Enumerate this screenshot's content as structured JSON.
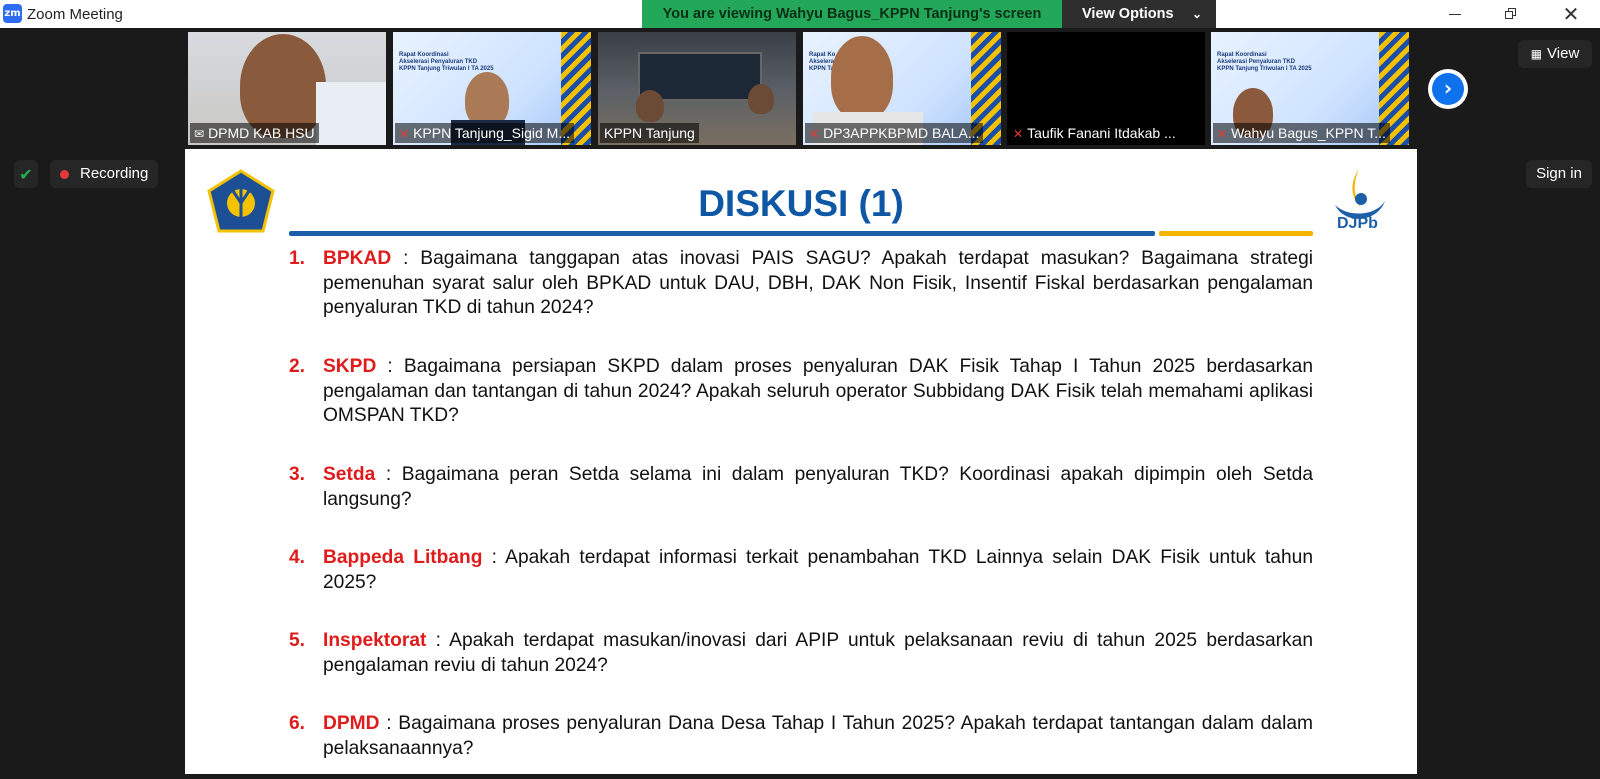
{
  "window": {
    "title": "Zoom Meeting",
    "logo_text": "zm"
  },
  "banner": {
    "text": "You are viewing Wahyu Bagus_KPPN Tanjung's screen",
    "view_options": "View Options"
  },
  "participants": [
    {
      "name": "DPMD KAB HSU",
      "muted": false
    },
    {
      "name": "KPPN Tanjung_Sigid M...",
      "muted": true
    },
    {
      "name": "KPPN Tanjung",
      "muted": false
    },
    {
      "name": "DP3APPKBPMD BALA...",
      "muted": true
    },
    {
      "name": "Taufik Fanani Itdakab ...",
      "muted": true
    },
    {
      "name": "Wahyu Bagus_KPPN T...",
      "muted": true
    }
  ],
  "controls": {
    "view": "View",
    "recording": "Recording",
    "sign_in": "Sign in"
  },
  "colors": {
    "accent": "#0e72ed",
    "banner": "#23a85a",
    "recording": "#e5383b",
    "slide_title": "#0e57a4",
    "heading_red": "#e01b1b"
  },
  "slide": {
    "title": "DISKUSI (1)",
    "brand": "DJPb",
    "questions": [
      {
        "num": "1.",
        "head": "BPKAD",
        "text": " : Bagaimana tanggapan atas inovasi PAIS SAGU? Apakah terdapat masukan? Bagaimana strategi pemenuhan syarat salur oleh BPKAD untuk DAU, DBH, DAK Non Fisik, Insentif Fiskal berdasarkan pengalaman penyaluran TKD di tahun 2024?"
      },
      {
        "num": "2.",
        "head": "SKPD",
        "text": " : Bagaimana persiapan SKPD dalam proses penyaluran DAK Fisik Tahap I Tahun 2025 berdasarkan pengalaman dan tantangan di tahun 2024? Apakah seluruh operator Subbidang DAK Fisik telah memahami aplikasi OMSPAN TKD?"
      },
      {
        "num": "3.",
        "head": "Setda",
        "text": " : Bagaimana peran Setda selama ini dalam penyaluran TKD? Koordinasi apakah dipimpin oleh Setda langsung?"
      },
      {
        "num": "4.",
        "head": "Bappeda Litbang",
        "text": " : Apakah terdapat informasi terkait penambahan TKD Lainnya selain DAK Fisik untuk tahun 2025?"
      },
      {
        "num": "5.",
        "head": "Inspektorat",
        "text": " : Apakah terdapat masukan/inovasi dari APIP untuk pelaksanaan reviu di tahun 2025 berdasarkan pengalaman reviu di tahun 2024?"
      },
      {
        "num": "6.",
        "head": "DPMD",
        "text": " : Bagaimana proses penyaluran Dana Desa Tahap I Tahun 2025? Apakah terdapat tantangan dalam dalam pelaksanaannya?"
      }
    ]
  }
}
